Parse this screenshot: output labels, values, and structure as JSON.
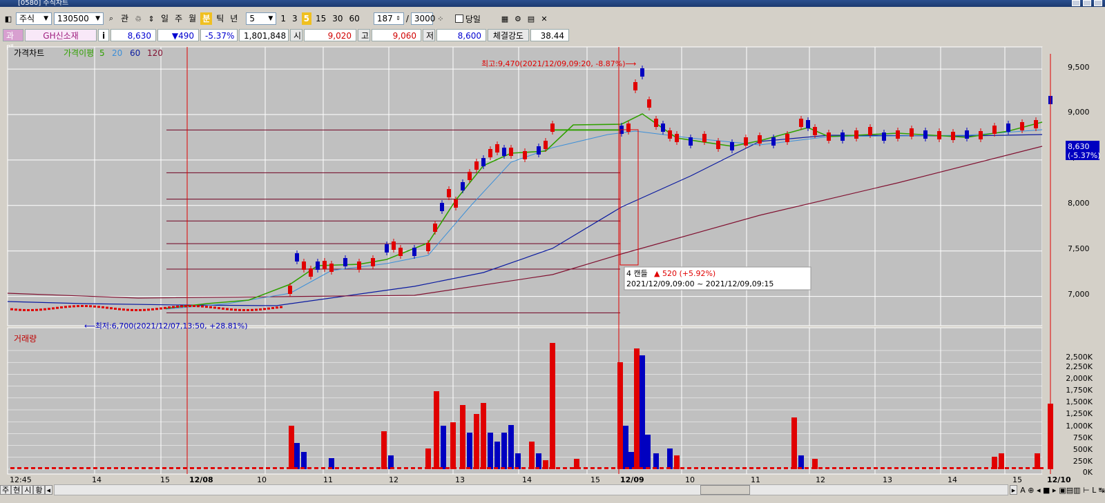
{
  "window": {
    "title": "[0580] 주식차트"
  },
  "toolbar": {
    "market": "주식",
    "code": "130500",
    "btn_search": "관",
    "periods": [
      "일",
      "주",
      "월",
      "분",
      "틱",
      "년"
    ],
    "selected_period": "분",
    "interval_value": "5",
    "minute_buttons": [
      "1",
      "3",
      "5",
      "15",
      "30",
      "60"
    ],
    "selected_minute": "5",
    "count": "187",
    "count_sep": "/",
    "total": "3000",
    "today_label": "당일"
  },
  "info": {
    "tag": "과메",
    "name": "GH신소재",
    "info_btn": "i",
    "price": "8,630",
    "change": "▼490",
    "change_pct": "-5.37%",
    "volume": "1,801,848",
    "open_label": "시",
    "open": "9,020",
    "high_label": "고",
    "high": "9,060",
    "low_label": "저",
    "low": "8,600",
    "strength_label": "체결강도",
    "strength": "38.44"
  },
  "price_chart": {
    "title": "가격차트",
    "ma_title": "가격이평",
    "ma_periods": [
      "5",
      "20",
      "60",
      "120"
    ],
    "y_ticks": [
      "9,500",
      "9,000",
      "8,500",
      "8,000",
      "7,500",
      "7,000"
    ],
    "current_price_label": "8,630",
    "current_change_label": "(-5.37%)",
    "max_annotation": "최고:9,470(2021/12/09,09:20, -8.87%)⟶",
    "min_annotation": "⟵최저:6,700(2021/12/07,13:50, +28.81%)",
    "tooltip_line1_prefix": "4 캔들",
    "tooltip_line1_value": "▲ 520 (+5.92%)",
    "tooltip_line2": "2021/12/09,09:00 ~ 2021/12/09,09:15"
  },
  "volume_chart": {
    "title": "거래량",
    "y_ticks": [
      "2,500K",
      "2,250K",
      "2,000K",
      "1,750K",
      "1,500K",
      "1,250K",
      "1,000K",
      "750K",
      "500K",
      "250K",
      "0K"
    ]
  },
  "x_axis": {
    "labels": [
      "12:45",
      "14",
      "15",
      "12/08",
      "10",
      "11",
      "12",
      "13",
      "14",
      "15",
      "12/09",
      "10",
      "11",
      "12",
      "13",
      "14",
      "15",
      "12/10"
    ]
  },
  "bottom": {
    "tabs": [
      "주",
      "현",
      "시",
      "황"
    ]
  },
  "colors": {
    "up": "#e00000",
    "down": "#0000c0",
    "ma5": "#30a000",
    "ma20": "#3c8fd8",
    "ma60": "#0a1aa0",
    "ma120": "#801030",
    "grid": "#ffffff",
    "chart_bg": "#c0c0c0",
    "marker": "#e00000"
  }
}
